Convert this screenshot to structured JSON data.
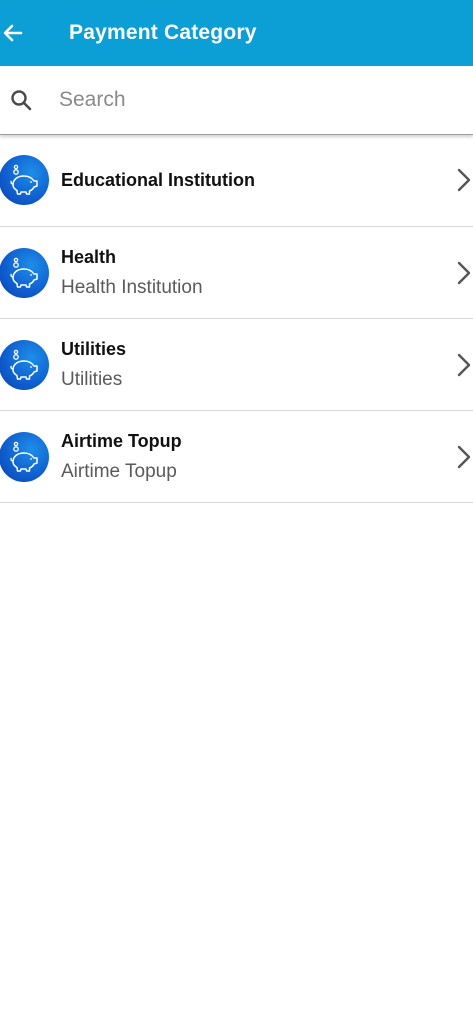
{
  "header": {
    "title": "Payment Category",
    "back_icon": "arrow-left-icon",
    "background_color": "#0b9fd6"
  },
  "search": {
    "placeholder": "Search",
    "value": "",
    "icon": "search-icon"
  },
  "categories": [
    {
      "title": "Educational Institution",
      "subtitle": "",
      "icon": "piggy-bank-icon"
    },
    {
      "title": "Health",
      "subtitle": "Health Institution",
      "icon": "piggy-bank-icon"
    },
    {
      "title": "Utilities",
      "subtitle": "Utilities",
      "icon": "piggy-bank-icon"
    },
    {
      "title": "Airtime Topup",
      "subtitle": "Airtime Topup",
      "icon": "piggy-bank-icon"
    }
  ]
}
